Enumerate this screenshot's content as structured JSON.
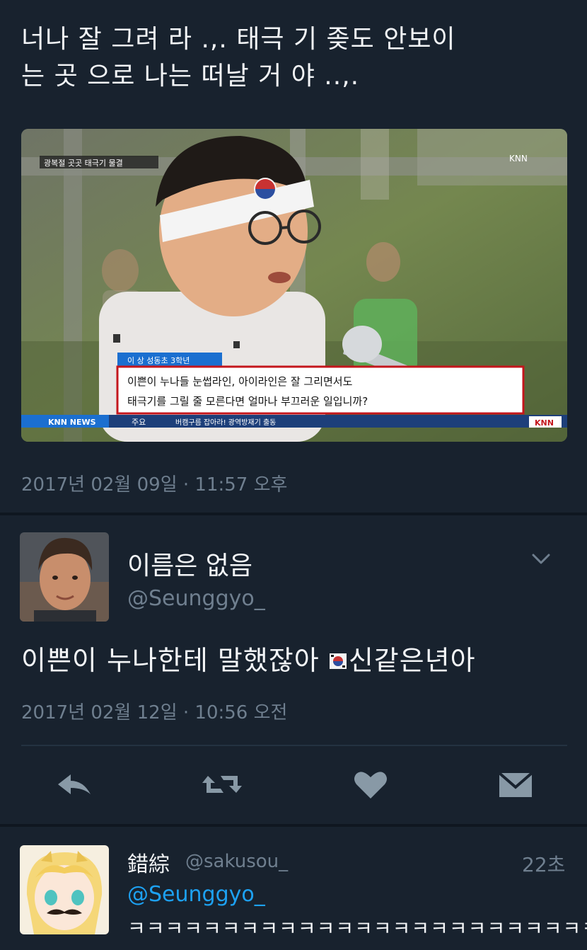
{
  "tweet": {
    "text_line1": "너나 잘 그려 라 .,. 태극 기 좆도 안보이",
    "text_line2": "는 곳 으로 나는 떠날 거  야 ..,.",
    "timestamp": "2017년 02월 09일 · 11:57 오후",
    "media": {
      "corner_caption": "광복절 곳곳 태극기 물결",
      "channel_logo": "KNN",
      "name_tag": "이 상 성동초 3학년",
      "caption_line1": "이쁜이 누나들 눈썹라인, 아이라인은 잘 그리면서도",
      "caption_line2": "태극기를 그릴 줄 모른다면 얼마나 부끄러운 일입니까?",
      "news_brand": "KNN NEWS",
      "ticker_label": "주요",
      "ticker_text": "버캠구름 잡아라! 광역방재기 출동",
      "bottom_logo": "KNN"
    }
  },
  "reply": {
    "name": "이름은 없음",
    "handle": "@Seunggyo_",
    "text": "이쁜이 누나한테 말했잖아 병신같은년아",
    "text_before_icon": "이쁜이 누나한테 말했잖아 ",
    "text_after_icon": "신같은년아",
    "timestamp": "2017년 02월 12일 · 10:56 오전",
    "avatar_icon": "person-photo-avatar",
    "menu_icon": "chevron-down-icon"
  },
  "actions": {
    "reply_icon": "reply-icon",
    "retweet_icon": "retweet-icon",
    "like_icon": "heart-icon",
    "message_icon": "envelope-icon"
  },
  "comment": {
    "name": "錯綜",
    "handle": "@sakusou_",
    "time": "22초",
    "mention": "@Seunggyo_",
    "text": "ㅋㅋㅋㅋㅋㅋㅋㅋㅋㅋㅋㅋㅋㅋㅋㅋㅋㅋㅋㅋㅋㅋㅋㅋㅋ",
    "avatar_icon": "anime-avatar"
  },
  "colors": {
    "background": "#18222e",
    "text": "#f3f5f7",
    "muted": "#6f7f8f",
    "link": "#1da1f2",
    "icon": "#8899a6"
  }
}
